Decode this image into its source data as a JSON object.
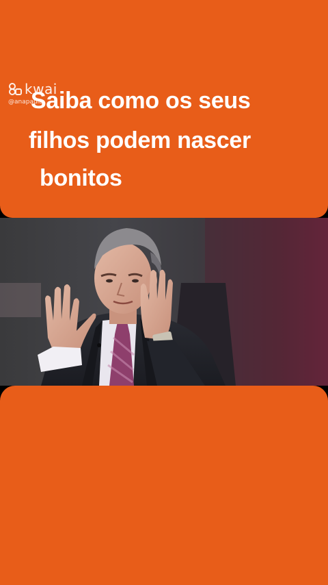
{
  "caption": {
    "line1": "Saiba como os  seus",
    "line2": "filhos podem nascer",
    "line3": "bonitos"
  },
  "watermark": {
    "app_name": "kwai",
    "handle": "@anapaula"
  },
  "colors": {
    "panel": "#e85d19",
    "background": "#000000",
    "text": "#ffffff"
  },
  "video": {
    "subject": "man in suit gesturing with both hands raised"
  }
}
